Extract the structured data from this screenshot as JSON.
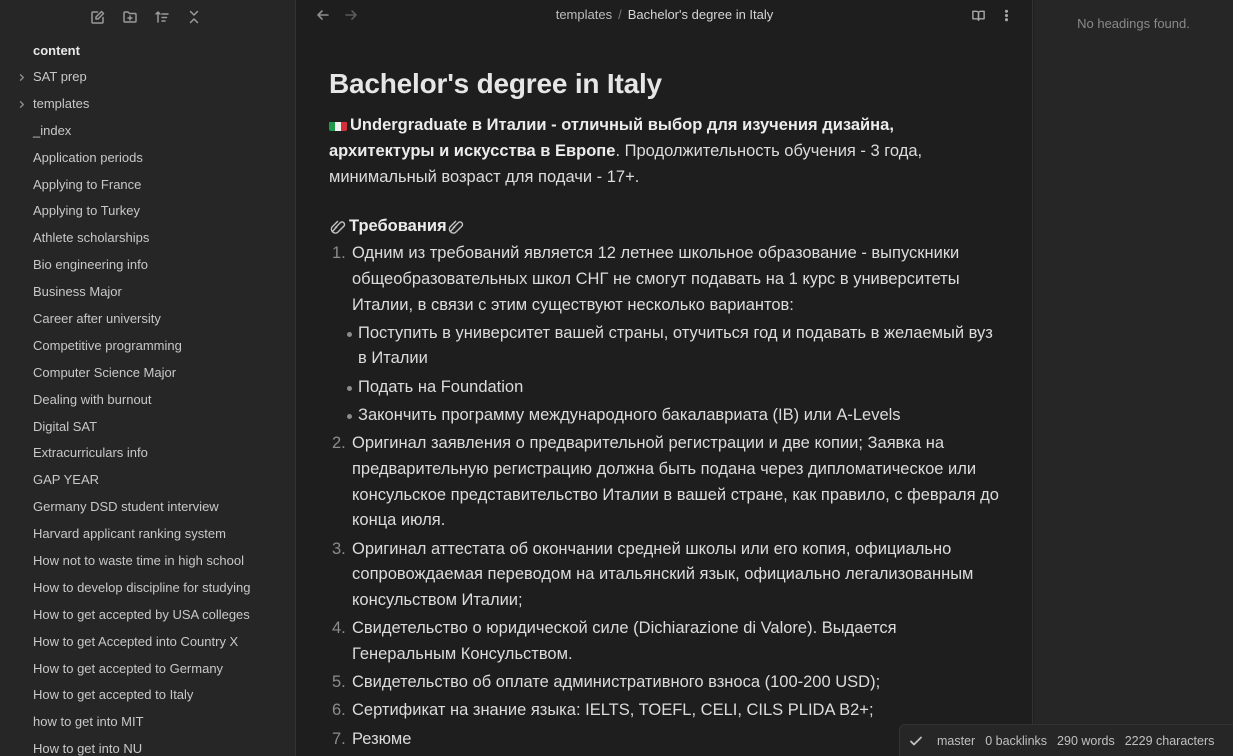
{
  "sidebar": {
    "root_label": "content",
    "items": [
      {
        "label": "SAT prep",
        "folder": true
      },
      {
        "label": "templates",
        "folder": true
      },
      {
        "label": "_index"
      },
      {
        "label": "Application periods"
      },
      {
        "label": "Applying to France"
      },
      {
        "label": "Applying to Turkey"
      },
      {
        "label": "Athlete scholarships"
      },
      {
        "label": "Bio engineering info"
      },
      {
        "label": "Business Major"
      },
      {
        "label": "Career after university"
      },
      {
        "label": "Competitive programming"
      },
      {
        "label": "Computer Science Major"
      },
      {
        "label": "Dealing with burnout"
      },
      {
        "label": "Digital SAT"
      },
      {
        "label": "Extracurriculars info"
      },
      {
        "label": "GAP YEAR"
      },
      {
        "label": "Germany DSD student interview"
      },
      {
        "label": "Harvard applicant ranking system"
      },
      {
        "label": "How not to waste time in high school"
      },
      {
        "label": "How to develop discipline for studying"
      },
      {
        "label": "How to get accepted by USA colleges"
      },
      {
        "label": "How to get Accepted into Country X"
      },
      {
        "label": "How to get accepted to Germany"
      },
      {
        "label": "How to get accepted to Italy"
      },
      {
        "label": "how to get into MIT"
      },
      {
        "label": "How to get into NU"
      }
    ]
  },
  "breadcrumb": {
    "folder": "templates",
    "separator": "/",
    "current": "Bachelor's degree in Italy"
  },
  "document": {
    "title": "Bachelor's degree in Italy",
    "intro_bold": "Undergraduate в Италии - отличный выбор для изучения дизайна, архитектуры и искусства в Европе",
    "intro_rest": ". Продолжительность обучения - 3 года, минимальный возраст для подачи - 17+.",
    "requirements_heading": "Требования",
    "requirements": [
      {
        "num": "1.",
        "text": "Одним из требований является 12 летнее школьное образование - выпускники общеобразовательных школ СНГ не смогут подавать на 1 курс в университеты Италии, в связи с этим существуют несколько вариантов:"
      },
      {
        "num": "2.",
        "text": "Оригинал заявления о предварительной регистрации и две копии; Заявка на предварительную регистрацию должна быть подана через дипломатическое или консульское представительство Италии в вашей стране, как правило, с февраля до конца июля."
      },
      {
        "num": "3.",
        "text": "Оригинал аттестата об окончании средней школы или его копия, официально сопровождаемая переводом на итальянский язык, официально легализованным консульством Италии;"
      },
      {
        "num": "4.",
        "text": "Свидетельство о юридической силе (Dichiarazione di Valore). Выдается Генеральным Консульством."
      },
      {
        "num": "5.",
        "text": "Свидетельство об оплате административного взноса (100-200 USD);"
      },
      {
        "num": "6.",
        "text": "Сертификат на знание языка: IELTS, TOEFL, CELI, CILS PLIDA B2+;"
      },
      {
        "num": "7.",
        "text": "Резюме"
      }
    ],
    "options": [
      "Поступить в университет вашей страны, отучиться год и подавать в желаемый вуз в Италии",
      "Подать на Foundation",
      "Закончить программу международного бакалавриата (IB) или A-Levels"
    ]
  },
  "outline": {
    "empty_text": "No headings found."
  },
  "status_bar": {
    "branch": "master",
    "backlinks": "0 backlinks",
    "words": "290 words",
    "characters": "2229 characters"
  },
  "colors": {
    "flag_green": "#1f9a4a",
    "flag_white": "#f2f2f2",
    "flag_red": "#d3303a"
  }
}
